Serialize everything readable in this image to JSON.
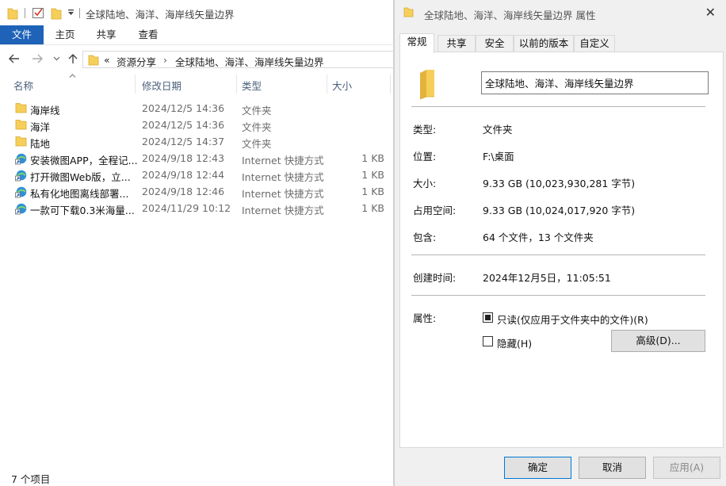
{
  "explorer": {
    "title": "全球陆地、海洋、海岸线矢量边界",
    "ribbon_tabs": [
      "文件",
      "主页",
      "共享",
      "查看"
    ],
    "address": {
      "overflow": "«",
      "crumbs": [
        "资源分享",
        "全球陆地、海洋、海岸线矢量边界"
      ]
    },
    "columns": [
      "名称",
      "修改日期",
      "类型",
      "大小"
    ],
    "files": [
      {
        "name": "海岸线",
        "date": "2024/12/5 14:36",
        "type": "文件夹",
        "size": "",
        "icon": "folder-icon"
      },
      {
        "name": "海洋",
        "date": "2024/12/5 14:36",
        "type": "文件夹",
        "size": "",
        "icon": "folder-icon"
      },
      {
        "name": "陆地",
        "date": "2024/12/5 14:37",
        "type": "文件夹",
        "size": "",
        "icon": "folder-icon"
      },
      {
        "name": "安装微图APP，全程记...",
        "date": "2024/9/18 12:43",
        "type": "Internet 快捷方式",
        "size": "1 KB",
        "icon": "internet-shortcut-icon"
      },
      {
        "name": "打开微图Web版，立...",
        "date": "2024/9/18 12:44",
        "type": "Internet 快捷方式",
        "size": "1 KB",
        "icon": "internet-shortcut-icon"
      },
      {
        "name": "私有化地图离线部署...",
        "date": "2024/9/18 12:46",
        "type": "Internet 快捷方式",
        "size": "1 KB",
        "icon": "internet-shortcut-icon"
      },
      {
        "name": "一款可下载0.3米海量...",
        "date": "2024/11/29 10:12",
        "type": "Internet 快捷方式",
        "size": "1 KB",
        "icon": "internet-shortcut-icon"
      }
    ],
    "status": "7 个项目"
  },
  "dialog": {
    "title": "全球陆地、海洋、海岸线矢量边界 属性",
    "tabs": [
      "常规",
      "共享",
      "安全",
      "以前的版本",
      "自定义"
    ],
    "name": "全球陆地、海洋、海岸线矢量边界",
    "props": {
      "type_label": "类型:",
      "type_value": "文件夹",
      "location_label": "位置:",
      "location_value": "F:\\桌面",
      "size_label": "大小:",
      "size_value": "9.33 GB (10,023,930,281 字节)",
      "disk_label": "占用空间:",
      "disk_value": "9.33 GB (10,024,017,920 字节)",
      "contains_label": "包含:",
      "contains_value": "64 个文件，13 个文件夹",
      "created_label": "创建时间:",
      "created_value": "2024年12月5日，11:05:51",
      "attr_label": "属性:"
    },
    "readonly_label": "只读(仅应用于文件夹中的文件)(R)",
    "readonly_checked": true,
    "hidden_label": "隐藏(H)",
    "hidden_checked": false,
    "advanced_button": "高级(D)...",
    "ok_button": "确定",
    "cancel_button": "取消",
    "apply_button": "应用(A)"
  },
  "colors": {
    "accent": "#1e63b8",
    "folder": "#f6cf5b",
    "folder_dark": "#e3b33c"
  }
}
